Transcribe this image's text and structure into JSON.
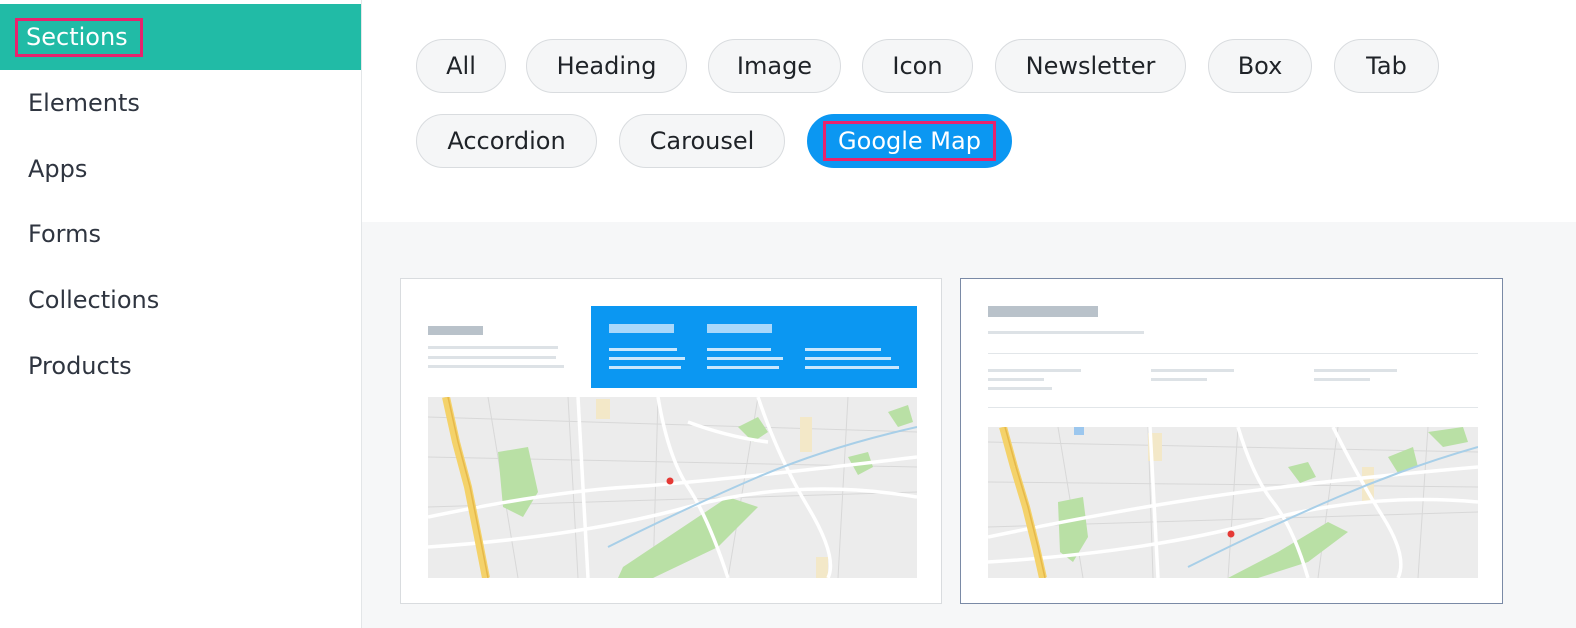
{
  "sidebar": {
    "items": [
      {
        "label": "Sections",
        "active": true
      },
      {
        "label": "Elements"
      },
      {
        "label": "Apps"
      },
      {
        "label": "Forms"
      },
      {
        "label": "Collections"
      },
      {
        "label": "Products"
      }
    ]
  },
  "filters": {
    "chips": [
      {
        "label": "All"
      },
      {
        "label": "Heading"
      },
      {
        "label": "Image"
      },
      {
        "label": "Icon"
      },
      {
        "label": "Newsletter"
      },
      {
        "label": "Box"
      },
      {
        "label": "Tab"
      },
      {
        "label": "Accordion"
      },
      {
        "label": "Carousel"
      },
      {
        "label": "Google Map",
        "active": true
      }
    ]
  },
  "colors": {
    "sidebar_active": "#21bba6",
    "chip_active": "#0b97f2",
    "highlight": "#e8236d"
  }
}
